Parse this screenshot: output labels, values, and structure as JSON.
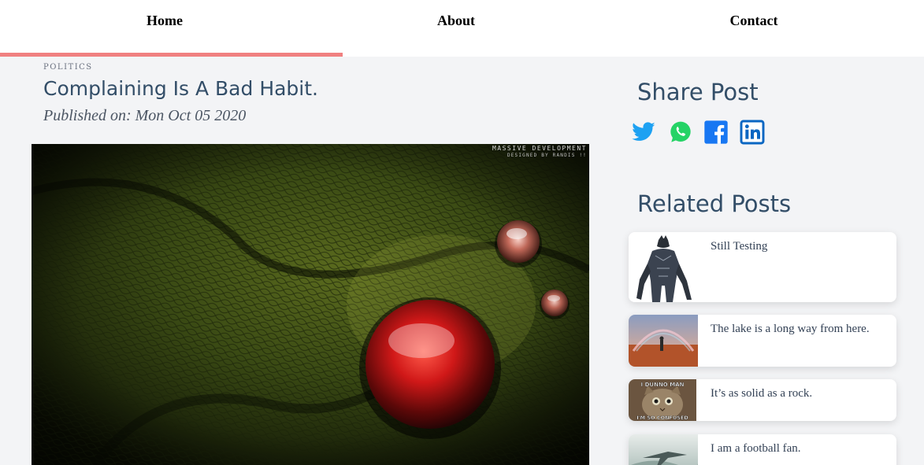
{
  "nav": {
    "items": [
      {
        "label": "Home"
      },
      {
        "label": "About"
      },
      {
        "label": "Contact"
      }
    ],
    "active_color": "#f08080"
  },
  "article": {
    "category": "POLITICS",
    "title": "Complaining Is A Bad Habit.",
    "published": "Published on: Mon Oct 05 2020",
    "hero_watermark_line1": "MASSIVE DEVELOPMENT",
    "hero_watermark_line2": "DESIGNED BY RANDIS !!"
  },
  "sidebar": {
    "share_title": "Share Post",
    "share_icons": [
      "twitter-icon",
      "whatsapp-icon",
      "facebook-icon",
      "linkedin-icon"
    ],
    "related_title": "Related Posts",
    "related": [
      {
        "title": "Still Testing",
        "thumb": "black-panther"
      },
      {
        "title": "The lake is a long way from here.",
        "thumb": "desert-rainbow"
      },
      {
        "title": "It’s as solid as a rock.",
        "thumb": "confused-cat",
        "thumb_caption_top": "I DUNNO MAN",
        "thumb_caption_bottom": "I'M SO CONFUSED"
      },
      {
        "title": "I am a football fan.",
        "thumb": "fighter-jet"
      }
    ]
  },
  "colors": {
    "heading": "#334e68",
    "twitter": "#1da1f2",
    "whatsapp": "#25d366",
    "facebook": "#1877f2",
    "linkedin": "#0a66c2"
  }
}
